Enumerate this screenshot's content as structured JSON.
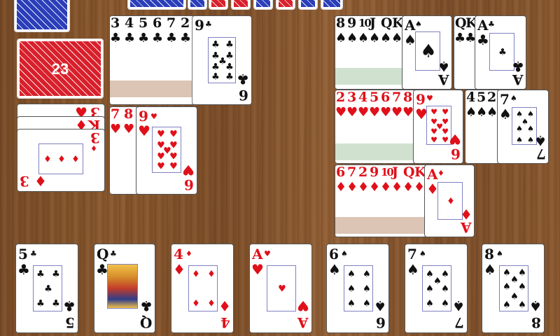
{
  "stock": {
    "count": "23"
  },
  "colors": {
    "red": "#e0101a",
    "black": "#111111",
    "table": "#8b5a30"
  },
  "foundation_top_left": {
    "strip": [
      {
        "r": "3",
        "s": "♣",
        "c": "black"
      },
      {
        "r": "4",
        "s": "♣",
        "c": "black"
      },
      {
        "r": "5",
        "s": "♣",
        "c": "black"
      },
      {
        "r": "6",
        "s": "♣",
        "c": "black"
      },
      {
        "r": "7",
        "s": "♣",
        "c": "black"
      },
      {
        "r": "2",
        "s": "♣",
        "c": "black"
      }
    ],
    "top": {
      "rank": "9",
      "suit": "♣",
      "color": "black",
      "bottom_rank": "6"
    }
  },
  "waste_left": {
    "stacked": [
      {
        "r": "3",
        "s": "♥"
      },
      {
        "r": "K",
        "s": "♦"
      },
      {
        "r": "3",
        "s": "♦"
      }
    ],
    "top": {
      "rank": "3",
      "suit": "♦",
      "color": "red"
    }
  },
  "pile_hearts_left": {
    "strip": [
      {
        "r": "7",
        "s": "♥",
        "c": "red"
      },
      {
        "r": "8",
        "s": "♥",
        "c": "red"
      }
    ],
    "top": {
      "rank": "9",
      "suit": "♥",
      "color": "red",
      "bottom_rank": "6"
    }
  },
  "spades_seq": {
    "strip": [
      {
        "r": "8",
        "s": "♠"
      },
      {
        "r": "9",
        "s": "♠"
      },
      {
        "r": "10",
        "s": "♠"
      },
      {
        "r": "J",
        "s": "♠"
      },
      {
        "r": "Q",
        "s": "♠"
      },
      {
        "r": "K",
        "s": "♠"
      }
    ],
    "top": {
      "rank": "A",
      "suit": "♠",
      "color": "black",
      "bottom_rank": "A"
    }
  },
  "clubs_small": {
    "strip": [
      {
        "r": "Q",
        "s": "♣"
      },
      {
        "r": "K",
        "s": "♣"
      }
    ],
    "top": {
      "rank": "A",
      "suit": "♣",
      "color": "black",
      "bottom_rank": "A"
    }
  },
  "hearts_seq": {
    "strip": [
      {
        "r": "2",
        "s": "♥"
      },
      {
        "r": "3",
        "s": "♥"
      },
      {
        "r": "4",
        "s": "♥"
      },
      {
        "r": "5",
        "s": "♥"
      },
      {
        "r": "6",
        "s": "♥"
      },
      {
        "r": "7",
        "s": "♥"
      },
      {
        "r": "8",
        "s": "♥"
      }
    ],
    "top": {
      "rank": "9",
      "suit": "♥",
      "color": "red",
      "bottom_rank": "6"
    }
  },
  "spades_small": {
    "strip": [
      {
        "r": "4",
        "s": "♠"
      },
      {
        "r": "5",
        "s": "♠"
      },
      {
        "r": "2",
        "s": "♠"
      }
    ],
    "top": {
      "rank": "7",
      "suit": "♠",
      "color": "black",
      "bottom_rank": "7"
    }
  },
  "diamonds_seq": {
    "strip": [
      {
        "r": "6",
        "s": "♦"
      },
      {
        "r": "7",
        "s": "♦"
      },
      {
        "r": "2",
        "s": "♦"
      },
      {
        "r": "9",
        "s": "♦"
      },
      {
        "r": "10",
        "s": "♦"
      },
      {
        "r": "J",
        "s": "♦"
      },
      {
        "r": "Q",
        "s": "♦"
      },
      {
        "r": "K",
        "s": "♦"
      }
    ],
    "top": {
      "rank": "A",
      "suit": "♦",
      "color": "red",
      "bottom_rank": "A"
    }
  },
  "hand": [
    {
      "rank": "5",
      "suit": "♣",
      "color": "black"
    },
    {
      "rank": "Q",
      "suit": "♣",
      "color": "black"
    },
    {
      "rank": "4",
      "suit": "♦",
      "color": "red"
    },
    {
      "rank": "A",
      "suit": "♥",
      "color": "red"
    },
    {
      "rank": "6",
      "suit": "♠",
      "color": "black"
    },
    {
      "rank": "7",
      "suit": "♠",
      "color": "black"
    },
    {
      "rank": "8",
      "suit": "♠",
      "color": "black"
    }
  ]
}
